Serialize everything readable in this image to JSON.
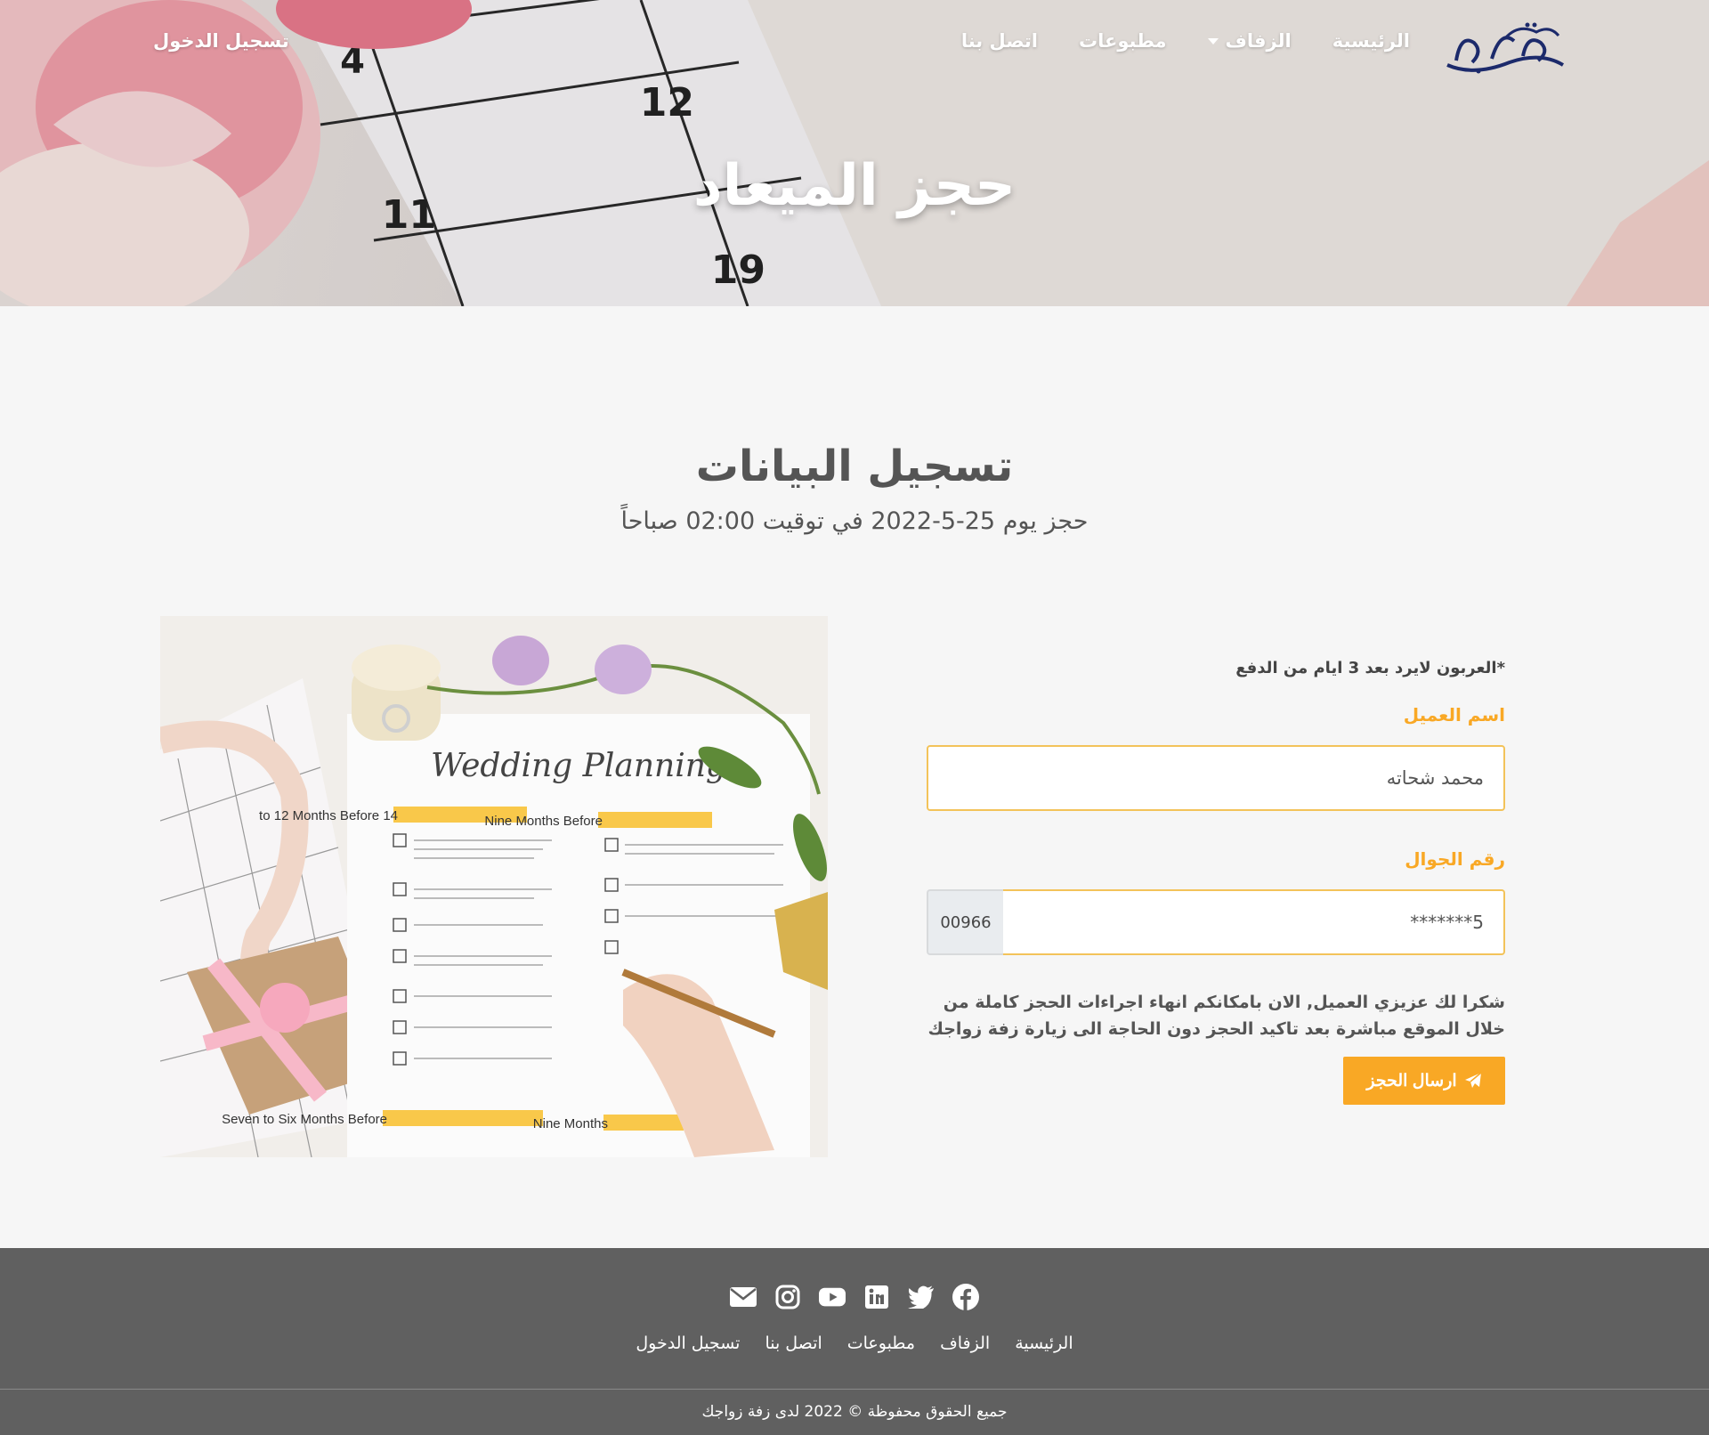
{
  "nav": {
    "logo_text": "زفة زواجك",
    "links": [
      {
        "label": "الرئيسية"
      },
      {
        "label": "الزفاف"
      },
      {
        "label": "مطبوعات"
      },
      {
        "label": "اتصل بنا"
      }
    ],
    "login": "تسجيل الدخول"
  },
  "hero": {
    "title": "حجز الميعاد",
    "calendar_numbers": [
      "4",
      "12",
      "11",
      "19"
    ]
  },
  "section": {
    "title": "تسجيل البيانات",
    "subtitle": "حجز يوم 25-5-2022 في توقيت 02:00 صباحاً"
  },
  "form": {
    "note": "*العربون لايرد بعد 3 ايام من الدفع",
    "name_label": "اسم العميل",
    "name_value": "محمد شحاته",
    "phone_label": "رقم الجوال",
    "phone_value": "5*******",
    "phone_prefix": "00966",
    "thanks": "شكرا لك عزيزي العميل, الان بامكانكم انهاء اجراءات الحجز كاملة من خلال الموقع مباشرة بعد تاكيد الحجز دون الحاجة الى زيارة زفة زواجك",
    "submit": "ارسال الحجز"
  },
  "image": {
    "heading": "Wedding Planning",
    "sections": [
      "14 to 12 Months Before",
      "Nine Months Before",
      "Seven to Six Months Before",
      "Nine Months"
    ]
  },
  "footer": {
    "social_icons": [
      "facebook-icon",
      "twitter-icon",
      "linkedin-icon",
      "youtube-icon",
      "instagram-icon",
      "email-icon"
    ],
    "links": [
      {
        "label": "الرئيسية"
      },
      {
        "label": "الزفاف"
      },
      {
        "label": "مطبوعات"
      },
      {
        "label": "اتصل بنا"
      },
      {
        "label": "تسجيل الدخول"
      }
    ],
    "copyright": "جميع الحقوق محفوظة © 2022 لدى زفة زواجك"
  },
  "colors": {
    "accent": "#f9a825",
    "footer_bg": "#606060",
    "page_bg": "#f6f6f6",
    "logo": "#1c2a6b"
  }
}
